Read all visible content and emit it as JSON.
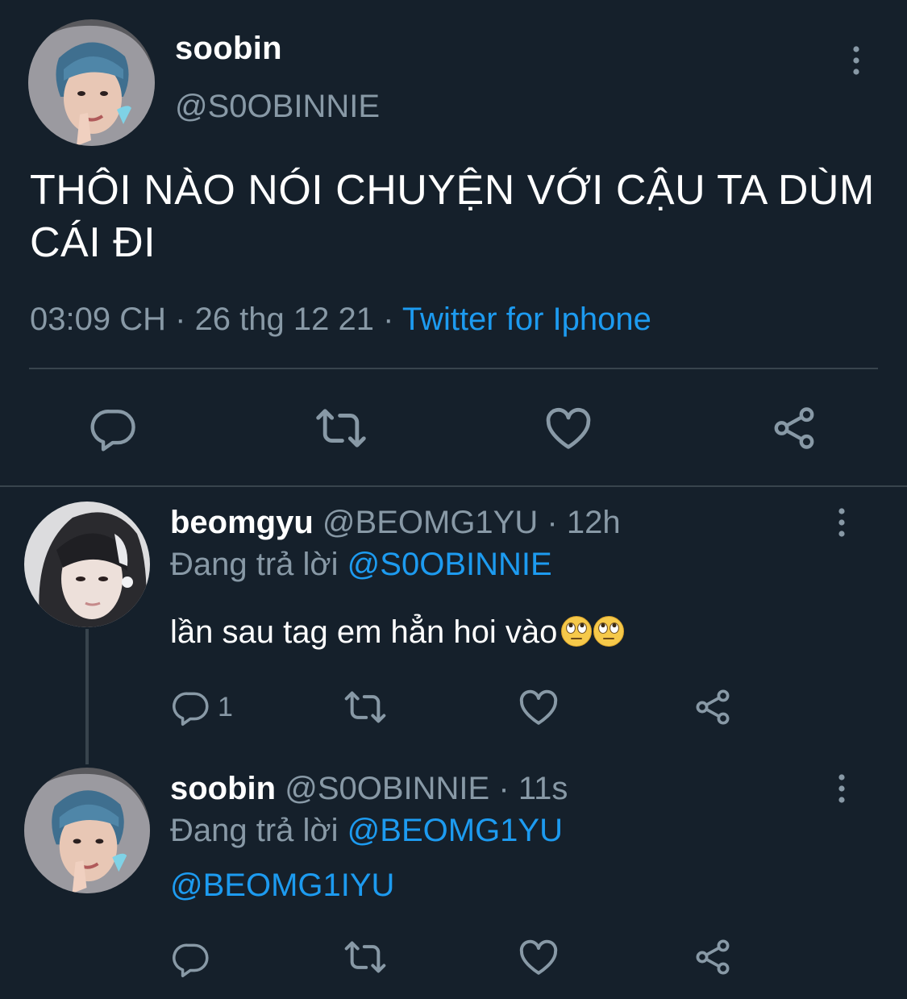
{
  "main_tweet": {
    "name": "soobin",
    "handle": "@S0OBINNIE",
    "text": "THÔI NÀO NÓI CHUYỆN VỚI CẬU TA DÙM CÁI ĐI",
    "time": "03:09 CH",
    "date": "26 thg 12 21",
    "separator": "·",
    "source": "Twitter for Iphone"
  },
  "replies": [
    {
      "name": "beomgyu",
      "handle": "@BEOMG1YU",
      "separator": "·",
      "time": "12h",
      "replying_prefix": "Đang trả lời",
      "replying_to": "@S0OBINNIE",
      "text": "lần sau tag em hẳn hoi vào",
      "emoji": [
        "face-with-rolling-eyes",
        "face-with-rolling-eyes"
      ],
      "reply_count": "1"
    },
    {
      "name": "soobin",
      "handle": "@S0OBINNIE",
      "separator": "·",
      "time": "11s",
      "replying_prefix": "Đang trả lời",
      "replying_to": "@BEOMG1YU",
      "text": "@BEOMG1IYU"
    }
  ],
  "colors": {
    "background": "#15202b",
    "text_primary": "#ffffff",
    "text_secondary": "#8899a6",
    "link": "#1d9bf0",
    "divider": "#38444d"
  },
  "icons": [
    "more-vertical-icon",
    "reply-icon",
    "retweet-icon",
    "like-icon",
    "share-icon"
  ]
}
